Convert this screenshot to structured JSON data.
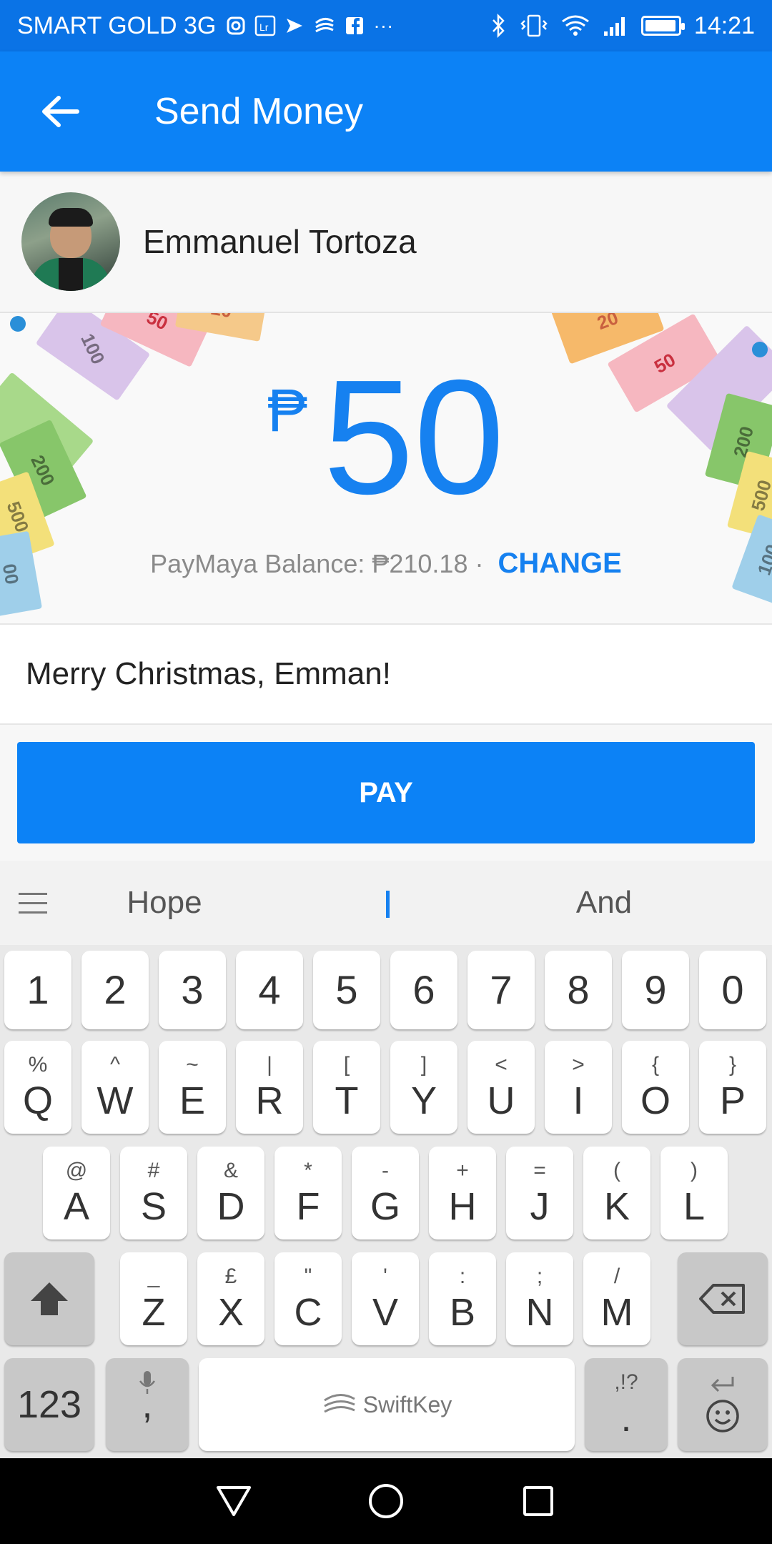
{
  "status_bar": {
    "carrier": "SMART GOLD 3G",
    "time": "14:21",
    "overflow": "···",
    "icons": [
      "instagram-icon",
      "lightroom-icon",
      "messenger-icon",
      "swiftkey-icon",
      "facebook-icon",
      "bluetooth-icon",
      "vibrate-icon",
      "wifi-icon",
      "signal-icon",
      "battery-icon"
    ]
  },
  "app_bar": {
    "title": "Send Money"
  },
  "recipient": {
    "name": "Emmanuel Tortoza"
  },
  "amount": {
    "currency": "₱",
    "value": "50",
    "balance_label": "PayMaya Balance: ₱210.18 ·",
    "change_label": "CHANGE"
  },
  "bills": [
    "50",
    "20",
    "100",
    "200",
    "500",
    "00",
    "100",
    "20",
    "50",
    "200",
    "500",
    "100"
  ],
  "message": {
    "text": "Merry Christmas, Emman!"
  },
  "pay": {
    "label": "PAY"
  },
  "keyboard": {
    "suggestions": [
      "Hope",
      "And"
    ],
    "number_row": [
      "1",
      "2",
      "3",
      "4",
      "5",
      "6",
      "7",
      "8",
      "9",
      "0"
    ],
    "row1": [
      {
        "main": "Q",
        "alt": "%"
      },
      {
        "main": "W",
        "alt": "^"
      },
      {
        "main": "E",
        "alt": "~"
      },
      {
        "main": "R",
        "alt": "|"
      },
      {
        "main": "T",
        "alt": "["
      },
      {
        "main": "Y",
        "alt": "]"
      },
      {
        "main": "U",
        "alt": "<"
      },
      {
        "main": "I",
        "alt": ">"
      },
      {
        "main": "O",
        "alt": "{"
      },
      {
        "main": "P",
        "alt": "}"
      }
    ],
    "row2": [
      {
        "main": "A",
        "alt": "@"
      },
      {
        "main": "S",
        "alt": "#"
      },
      {
        "main": "D",
        "alt": "&"
      },
      {
        "main": "F",
        "alt": "*"
      },
      {
        "main": "G",
        "alt": "-"
      },
      {
        "main": "H",
        "alt": "+"
      },
      {
        "main": "J",
        "alt": "="
      },
      {
        "main": "K",
        "alt": "("
      },
      {
        "main": "L",
        "alt": ")"
      }
    ],
    "row3": [
      {
        "main": "Z",
        "alt": "_"
      },
      {
        "main": "X",
        "alt": "£"
      },
      {
        "main": "C",
        "alt": "\""
      },
      {
        "main": "V",
        "alt": "'"
      },
      {
        "main": "B",
        "alt": ":"
      },
      {
        "main": "N",
        "alt": ";"
      },
      {
        "main": "M",
        "alt": "/"
      }
    ],
    "numbers_key": "123",
    "comma_key": ",",
    "space_label": "SwiftKey",
    "period_key": ".",
    "period_alt": ",!?"
  },
  "colors": {
    "primary": "#0c82f6",
    "status_bar": "#0a73e6",
    "accent_text": "#1681f0"
  }
}
